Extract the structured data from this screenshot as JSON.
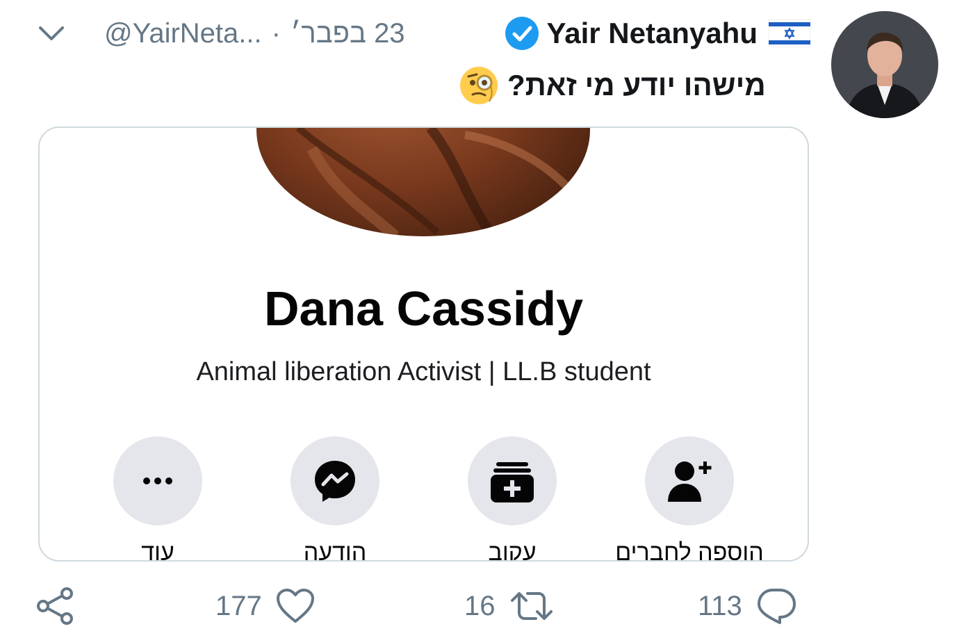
{
  "tweet": {
    "display_name": "Yair Netanyahu",
    "handle": "@YairNeta...",
    "date": "23 בפבר׳",
    "separator": "·",
    "text": "מישהו יודע מי זאת?",
    "emoji_icon": "face-with-monocle-icon",
    "verified_icon": "verified-badge-icon",
    "flag_icon": "israel-flag-icon"
  },
  "card": {
    "name": "Dana Cassidy",
    "bio": "Animal liberation Activist | LL.B student",
    "actions": [
      {
        "label": "עוד",
        "icon": "more-icon"
      },
      {
        "label": "הודעה",
        "icon": "messenger-icon"
      },
      {
        "label": "עקוב",
        "icon": "follow-icon"
      },
      {
        "label": "הוספה לחברים",
        "icon": "add-friend-icon"
      }
    ]
  },
  "footer": {
    "share_icon": "share-icon",
    "likes": "177",
    "retweets": "16",
    "replies": "113"
  },
  "colors": {
    "verified_blue": "#1d9bf0",
    "muted_text": "#657786",
    "action_circle": "#e4e6eb"
  }
}
